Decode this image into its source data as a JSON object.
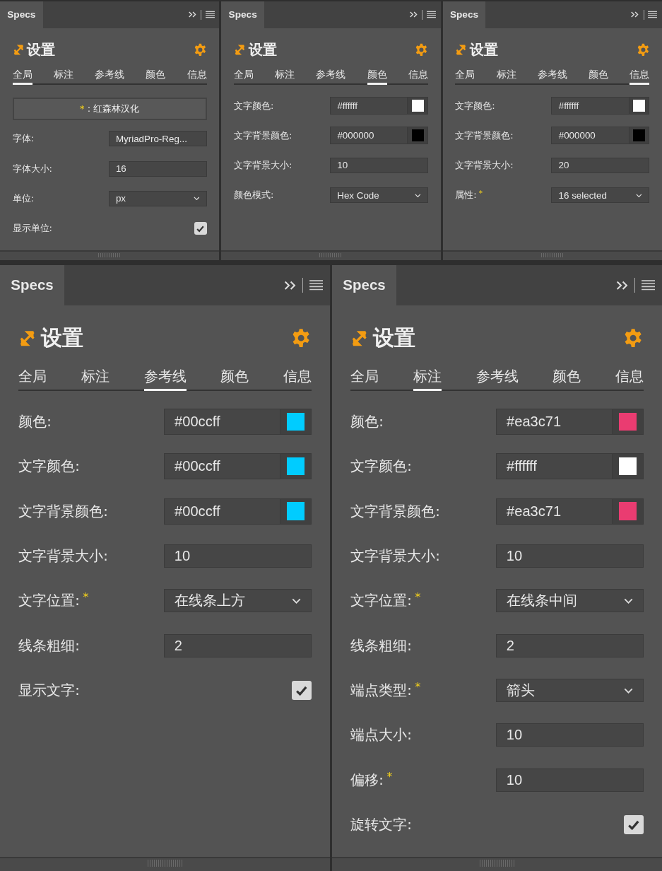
{
  "panels": [
    {
      "tab": "Specs",
      "title": "设置",
      "tabs": [
        {
          "label": "全局",
          "selected": true
        },
        {
          "label": "标注",
          "selected": false
        },
        {
          "label": "参考线",
          "selected": false
        },
        {
          "label": "颜色",
          "selected": false
        },
        {
          "label": "信息",
          "selected": false
        }
      ],
      "rows": [
        {
          "kind": "button",
          "star": "*",
          "label": ": 红森林汉化"
        },
        {
          "kind": "text",
          "label": "字体:",
          "value": "MyriadPro-Reg..."
        },
        {
          "kind": "text",
          "label": "字体大小:",
          "value": "16"
        },
        {
          "kind": "select",
          "label": "单位:",
          "value": "px"
        },
        {
          "kind": "checkbox",
          "label": "显示单位:",
          "checked": true
        }
      ]
    },
    {
      "tab": "Specs",
      "title": "设置",
      "tabs": [
        {
          "label": "全局",
          "selected": false
        },
        {
          "label": "标注",
          "selected": false
        },
        {
          "label": "参考线",
          "selected": false
        },
        {
          "label": "颜色",
          "selected": true
        },
        {
          "label": "信息",
          "selected": false
        }
      ],
      "rows": [
        {
          "kind": "color",
          "label": "文字颜色:",
          "value": "#ffffff",
          "color": "#ffffff"
        },
        {
          "kind": "color",
          "label": "文字背景颜色:",
          "value": "#000000",
          "color": "#000000"
        },
        {
          "kind": "text",
          "label": "文字背景大小:",
          "value": "10"
        },
        {
          "kind": "select",
          "label": "颜色模式:",
          "value": "Hex Code"
        }
      ]
    },
    {
      "tab": "Specs",
      "title": "设置",
      "tabs": [
        {
          "label": "全局",
          "selected": false
        },
        {
          "label": "标注",
          "selected": false
        },
        {
          "label": "参考线",
          "selected": false
        },
        {
          "label": "颜色",
          "selected": false
        },
        {
          "label": "信息",
          "selected": true
        }
      ],
      "rows": [
        {
          "kind": "color",
          "label": "文字颜色:",
          "value": "#ffffff",
          "color": "#ffffff"
        },
        {
          "kind": "color",
          "label": "文字背景颜色:",
          "value": "#000000",
          "color": "#000000"
        },
        {
          "kind": "text",
          "label": "文字背景大小:",
          "value": "20"
        },
        {
          "kind": "select",
          "label": "属性:",
          "star": "*",
          "value": "16 selected"
        }
      ]
    },
    {
      "tab": "Specs",
      "title": "设置",
      "tabs": [
        {
          "label": "全局",
          "selected": false
        },
        {
          "label": "标注",
          "selected": false
        },
        {
          "label": "参考线",
          "selected": true
        },
        {
          "label": "颜色",
          "selected": false
        },
        {
          "label": "信息",
          "selected": false
        }
      ],
      "rows": [
        {
          "kind": "color",
          "label": "颜色:",
          "value": "#00ccff",
          "color": "#00ccff"
        },
        {
          "kind": "color",
          "label": "文字颜色:",
          "value": "#00ccff",
          "color": "#00ccff"
        },
        {
          "kind": "color",
          "label": "文字背景颜色:",
          "value": "#00ccff",
          "color": "#00ccff"
        },
        {
          "kind": "text",
          "label": "文字背景大小:",
          "value": "10"
        },
        {
          "kind": "select",
          "label": "文字位置:",
          "star": "*",
          "value": "在线条上方"
        },
        {
          "kind": "text",
          "label": "线条粗细:",
          "value": "2"
        },
        {
          "kind": "checkbox",
          "label": "显示文字:",
          "checked": true
        }
      ]
    },
    {
      "tab": "Specs",
      "title": "设置",
      "tabs": [
        {
          "label": "全局",
          "selected": false
        },
        {
          "label": "标注",
          "selected": true
        },
        {
          "label": "参考线",
          "selected": false
        },
        {
          "label": "颜色",
          "selected": false
        },
        {
          "label": "信息",
          "selected": false
        }
      ],
      "rows": [
        {
          "kind": "color",
          "label": "颜色:",
          "value": "#ea3c71",
          "color": "#ea3c71"
        },
        {
          "kind": "color",
          "label": "文字颜色:",
          "value": "#ffffff",
          "color": "#ffffff"
        },
        {
          "kind": "color",
          "label": "文字背景颜色:",
          "value": "#ea3c71",
          "color": "#ea3c71"
        },
        {
          "kind": "text",
          "label": "文字背景大小:",
          "value": "10"
        },
        {
          "kind": "select",
          "label": "文字位置:",
          "star": "*",
          "value": "在线条中间"
        },
        {
          "kind": "text",
          "label": "线条粗细:",
          "value": "2"
        },
        {
          "kind": "select",
          "label": "端点类型:",
          "star": "*",
          "value": "箭头"
        },
        {
          "kind": "text",
          "label": "端点大小:",
          "value": "10"
        },
        {
          "kind": "text",
          "label": "偏移:",
          "star": "*",
          "value": "10"
        },
        {
          "kind": "checkbox",
          "label": "旋转文字:",
          "checked": true
        }
      ]
    }
  ]
}
